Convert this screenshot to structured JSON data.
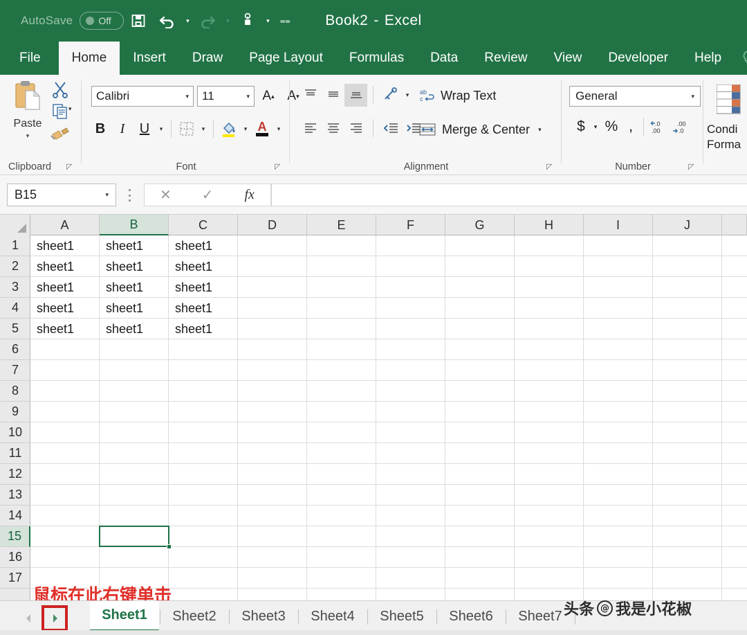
{
  "titlebar": {
    "autosave_label": "AutoSave",
    "autosave_state": "Off",
    "save_icon": "save-icon",
    "undo_icon": "undo-icon",
    "redo_icon": "redo-icon",
    "touch_icon": "touch-mode-icon",
    "customize_icon": "customize-qat-icon",
    "document_name": "Book2",
    "title_separator": "-",
    "app_name": "Excel"
  },
  "ribbon_tabs": [
    {
      "label": "File",
      "active": false
    },
    {
      "label": "Home",
      "active": true
    },
    {
      "label": "Insert",
      "active": false
    },
    {
      "label": "Draw",
      "active": false
    },
    {
      "label": "Page Layout",
      "active": false
    },
    {
      "label": "Formulas",
      "active": false
    },
    {
      "label": "Data",
      "active": false
    },
    {
      "label": "Review",
      "active": false
    },
    {
      "label": "View",
      "active": false
    },
    {
      "label": "Developer",
      "active": false
    },
    {
      "label": "Help",
      "active": false
    }
  ],
  "tellme_icon": "lightbulb-icon",
  "ribbon": {
    "clipboard": {
      "group_label": "Clipboard",
      "paste_label": "Paste",
      "paste_icon": "paste-icon",
      "cut_icon": "scissors-icon",
      "copy_icon": "copy-icon",
      "format_painter_icon": "format-painter-icon",
      "dialog_launcher": "dialog-launcher-icon"
    },
    "font": {
      "group_label": "Font",
      "font_family_value": "Calibri",
      "font_size_value": "11",
      "grow_font_icon": "grow-font-icon",
      "shrink_font_icon": "shrink-font-icon",
      "bold_label": "B",
      "italic_label": "I",
      "underline_label": "U",
      "borders_icon": "borders-icon",
      "fill_color_icon": "fill-color-icon",
      "font_color_icon": "font-color-icon",
      "dialog_launcher": "dialog-launcher-icon"
    },
    "alignment": {
      "group_label": "Alignment",
      "align_top_icon": "align-top-icon",
      "align_middle_icon": "align-middle-icon",
      "align_bottom_icon": "align-bottom-icon",
      "orientation_icon": "orientation-icon",
      "wrap_text_label": "Wrap Text",
      "wrap_text_icon": "wrap-text-icon",
      "align_left_icon": "align-left-icon",
      "align_center_icon": "align-center-icon",
      "align_right_icon": "align-right-icon",
      "decrease_indent_icon": "decrease-indent-icon",
      "increase_indent_icon": "increase-indent-icon",
      "merge_center_label": "Merge & Center",
      "merge_center_icon": "merge-center-icon",
      "dialog_launcher": "dialog-launcher-icon"
    },
    "number": {
      "group_label": "Number",
      "format_value": "General",
      "currency_label": "$",
      "percent_label": "%",
      "comma_label": ",",
      "increase_decimal_icon": "increase-decimal-icon",
      "decrease_decimal_icon": "decrease-decimal-icon",
      "dialog_launcher": "dialog-launcher-icon"
    },
    "styles": {
      "conditional_formatting_line1": "Condi",
      "conditional_formatting_line2": "Forma",
      "conditional_formatting_icon": "conditional-formatting-icon"
    }
  },
  "formula_bar": {
    "name_box_value": "B15",
    "cancel_icon": "cancel-icon",
    "enter_icon": "confirm-icon",
    "insert_function_icon": "fx-icon",
    "formula_value": ""
  },
  "grid": {
    "columns": [
      "A",
      "B",
      "C",
      "D",
      "E",
      "F",
      "G",
      "H",
      "I",
      "J"
    ],
    "selected_column": "B",
    "rows": [
      "1",
      "2",
      "3",
      "4",
      "5",
      "6",
      "7",
      "8",
      "9",
      "10",
      "11",
      "12",
      "13",
      "14",
      "15",
      "16",
      "17"
    ],
    "selected_row": "15",
    "cell_text": "sheet1",
    "data_rows": [
      {
        "row": "1",
        "A": "sheet1",
        "B": "sheet1",
        "C": "sheet1"
      },
      {
        "row": "2",
        "A": "sheet1",
        "B": "sheet1",
        "C": "sheet1"
      },
      {
        "row": "3",
        "A": "sheet1",
        "B": "sheet1",
        "C": "sheet1"
      },
      {
        "row": "4",
        "A": "sheet1",
        "B": "sheet1",
        "C": "sheet1"
      },
      {
        "row": "5",
        "A": "sheet1",
        "B": "sheet1",
        "C": "sheet1"
      }
    ],
    "active_cell": "B15",
    "annotation": "鼠标在此右键单击"
  },
  "sheet_tabs": {
    "prev_icon": "triangle-left-icon",
    "next_icon": "triangle-right-icon",
    "tabs": [
      {
        "label": "Sheet1",
        "active": true
      },
      {
        "label": "Sheet2",
        "active": false
      },
      {
        "label": "Sheet3",
        "active": false
      },
      {
        "label": "Sheet4",
        "active": false
      },
      {
        "label": "Sheet5",
        "active": false
      },
      {
        "label": "Sheet6",
        "active": false
      },
      {
        "label": "Sheet7",
        "active": false
      }
    ]
  },
  "watermark": {
    "prefix": "头条",
    "at": "@",
    "name": "我是小花椒"
  },
  "colors": {
    "excel_green": "#217346",
    "ribbon_bg": "#f5f6f5",
    "annotation_red": "#e0302a",
    "highlight_red": "#cc2222",
    "selection_green": "#1f7346"
  }
}
